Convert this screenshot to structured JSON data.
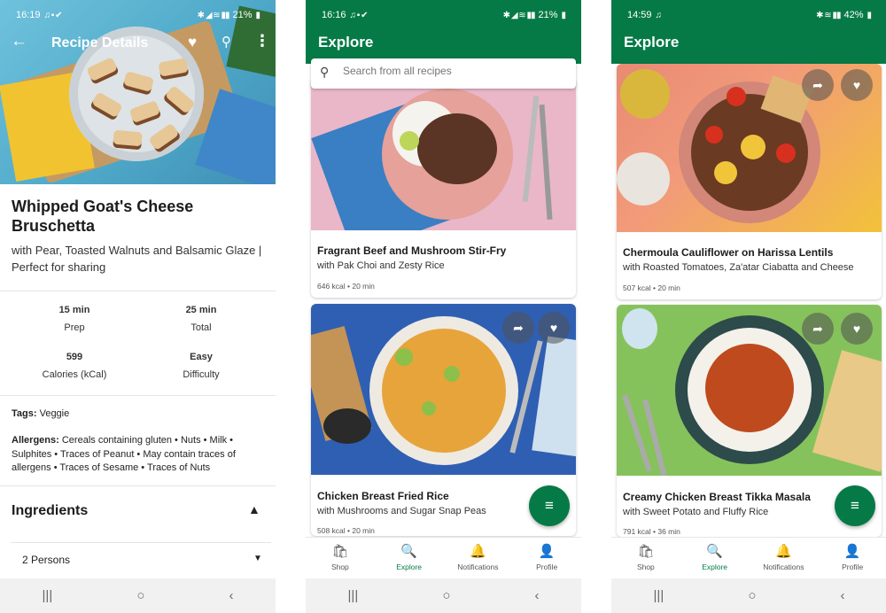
{
  "colors": {
    "brand_green": "#067a46",
    "text_dark": "#1c1c1c",
    "system_nav_bg": "#f1f1f1"
  },
  "phone1": {
    "status": {
      "time": "16:19",
      "battery": "21%"
    },
    "header": {
      "title": "Recipe Details",
      "back_icon": "arrow-left-icon",
      "favorite_icon": "heart-icon",
      "menu_icon": "more-vertical-icon"
    },
    "recipe": {
      "title": "Whipped Goat's Cheese Bruschetta",
      "subtitle": "with Pear, Toasted Walnuts and Balsamic Glaze | Perfect for sharing"
    },
    "stats": [
      {
        "value": "15 min",
        "label": "Prep"
      },
      {
        "value": "25 min",
        "label": "Total"
      },
      {
        "value": "599",
        "label": "Calories (kCal)"
      },
      {
        "value": "Easy",
        "label": "Difficulty"
      }
    ],
    "tags": {
      "label": "Tags:",
      "value": "Veggie"
    },
    "allergens": {
      "label": "Allergens:",
      "value": "Cereals containing gluten • Nuts • Milk • Sulphites • Traces of Peanut • May contain traces of allergens • Traces of Sesame • Traces of Nuts"
    },
    "ingredients": {
      "title": "Ingredients",
      "servings": "2 Persons"
    }
  },
  "phone2": {
    "status": {
      "time": "16:16",
      "battery": "21%"
    },
    "header": {
      "title": "Explore"
    },
    "search": {
      "placeholder": "Search from all recipes"
    },
    "cards": [
      {
        "title": "Fragrant Beef and Mushroom Stir-Fry",
        "subtitle": "with Pak Choi and Zesty Rice",
        "meta": "646 kcal • 20 min"
      },
      {
        "title": "Chicken Breast Fried Rice",
        "subtitle": "with Mushrooms and Sugar Snap Peas",
        "meta": "508 kcal • 20 min"
      }
    ]
  },
  "phone3": {
    "status": {
      "time": "14:59",
      "battery": "42%"
    },
    "header": {
      "title": "Explore"
    },
    "cards": [
      {
        "title": "Chermoula Cauliflower on Harissa Lentils",
        "subtitle": "with Roasted Tomatoes, Za'atar Ciabatta and Cheese",
        "meta": "507 kcal • 20 min"
      },
      {
        "title": "Creamy Chicken Breast Tikka Masala",
        "subtitle": "with Sweet Potato and Fluffy Rice",
        "meta": "791 kcal • 36 min"
      }
    ]
  },
  "tabs": [
    {
      "label": "Shop",
      "icon": "shopping-bag-icon"
    },
    {
      "label": "Explore",
      "icon": "explore-search-icon",
      "active": true
    },
    {
      "label": "Notifications",
      "icon": "bell-icon"
    },
    {
      "label": "Profile",
      "icon": "person-icon"
    }
  ],
  "system_nav": {
    "recents": "|||",
    "home": "○",
    "back": "‹"
  }
}
